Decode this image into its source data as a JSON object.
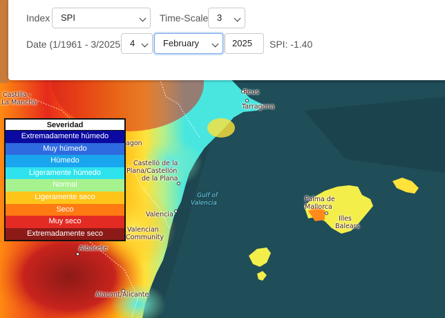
{
  "controls": {
    "index_label": "Index",
    "index_value": "SPI",
    "timescale_label": "Time-Scale",
    "timescale_value": "3",
    "date_label": "Date (1/1961 - 3/2025)",
    "day_value": "4",
    "month_value": "February",
    "year_value": "2025",
    "spi_readout": "SPI: -1.40"
  },
  "legend": {
    "title": "Severidad",
    "items": [
      {
        "label": "Extremadamente húmedo",
        "color": "#0a0aa0",
        "text": "#ffffff"
      },
      {
        "label": "Muy húmedo",
        "color": "#2f6be0",
        "text": "#ffffff"
      },
      {
        "label": "Húmedo",
        "color": "#19a6ee",
        "text": "#ffffff"
      },
      {
        "label": "Ligeramente húmedo",
        "color": "#2ee3ee",
        "text": "#ffffff"
      },
      {
        "label": "Normal",
        "color": "#a6f28e",
        "text": "#ffffff"
      },
      {
        "label": "Ligeramente seco",
        "color": "#ffc41a",
        "text": "#ffffff"
      },
      {
        "label": "Seco",
        "color": "#ff7a12",
        "text": "#ffffff"
      },
      {
        "label": "Muy seco",
        "color": "#e32b24",
        "text": "#ffffff"
      },
      {
        "label": "Extremadamente seco",
        "color": "#8c1a17",
        "text": "#ffffff"
      }
    ]
  },
  "places": {
    "castilla": "Castilla -",
    "la_mancha": "La Mancha",
    "reus": "Reus",
    "tarragona": "Tarragona",
    "aragon": "agon",
    "castello_1": "Castelló de la",
    "castello_2": "Plana/Castellón",
    "castello_3": "de la Plana",
    "valencia": "Valencia",
    "valencian_1": "Valencian",
    "valencian_2": "Community",
    "albacete": "Albacete",
    "alacant": "Alacant/Alicante",
    "gulf_1": "Gulf of",
    "gulf_2": "Valencia",
    "palma_1": "Palma de",
    "palma_2": "Mallorca",
    "illes_1": "Illes",
    "illes_2": "Balears"
  }
}
